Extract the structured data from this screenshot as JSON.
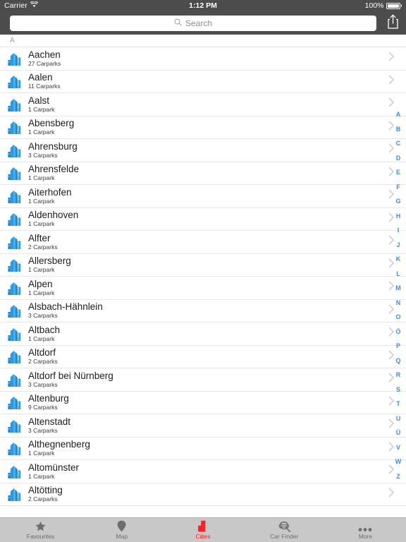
{
  "status_bar": {
    "carrier": "Carrier",
    "wifi_icon": "wifi-icon",
    "time": "1:12 PM",
    "battery_percent": "100%",
    "battery_icon": "battery-full-icon"
  },
  "nav_bar": {
    "search": {
      "placeholder": "Search",
      "value": "",
      "icon": "search-icon"
    },
    "share_button": {
      "icon": "share-icon",
      "label": ""
    }
  },
  "section": {
    "header": "A"
  },
  "list": {
    "rows": [
      {
        "city": "Aachen",
        "carparks": "27 Carparks",
        "icon": "city-buildings-icon",
        "chevron": "chevron-right-icon"
      },
      {
        "city": "Aalen",
        "carparks": "11 Carparks",
        "icon": "city-buildings-icon",
        "chevron": "chevron-right-icon"
      },
      {
        "city": "Aalst",
        "carparks": "1 Carpark",
        "icon": "city-buildings-icon",
        "chevron": "chevron-right-icon"
      },
      {
        "city": "Abensberg",
        "carparks": "1 Carpark",
        "icon": "city-buildings-icon",
        "chevron": "chevron-right-icon"
      },
      {
        "city": "Ahrensburg",
        "carparks": "3 Carparks",
        "icon": "city-buildings-icon",
        "chevron": "chevron-right-icon"
      },
      {
        "city": "Ahrensfelde",
        "carparks": "1 Carpark",
        "icon": "city-buildings-icon",
        "chevron": "chevron-right-icon"
      },
      {
        "city": "Aiterhofen",
        "carparks": "1 Carpark",
        "icon": "city-buildings-icon",
        "chevron": "chevron-right-icon"
      },
      {
        "city": "Aldenhoven",
        "carparks": "1 Carpark",
        "icon": "city-buildings-icon",
        "chevron": "chevron-right-icon"
      },
      {
        "city": "Alfter",
        "carparks": "2 Carparks",
        "icon": "city-buildings-icon",
        "chevron": "chevron-right-icon"
      },
      {
        "city": "Allersberg",
        "carparks": "1 Carpark",
        "icon": "city-buildings-icon",
        "chevron": "chevron-right-icon"
      },
      {
        "city": "Alpen",
        "carparks": "1 Carpark",
        "icon": "city-buildings-icon",
        "chevron": "chevron-right-icon"
      },
      {
        "city": "Alsbach-Hähnlein",
        "carparks": "3 Carparks",
        "icon": "city-buildings-icon",
        "chevron": "chevron-right-icon"
      },
      {
        "city": "Altbach",
        "carparks": "1 Carpark",
        "icon": "city-buildings-icon",
        "chevron": "chevron-right-icon"
      },
      {
        "city": "Altdorf",
        "carparks": "2 Carparks",
        "icon": "city-buildings-icon",
        "chevron": "chevron-right-icon"
      },
      {
        "city": "Altdorf bei Nürnberg",
        "carparks": "3 Carparks",
        "icon": "city-buildings-icon",
        "chevron": "chevron-right-icon"
      },
      {
        "city": "Altenburg",
        "carparks": "9 Carparks",
        "icon": "city-buildings-icon",
        "chevron": "chevron-right-icon"
      },
      {
        "city": "Altenstadt",
        "carparks": "3 Carparks",
        "icon": "city-buildings-icon",
        "chevron": "chevron-right-icon"
      },
      {
        "city": "Althegnenberg",
        "carparks": "1 Carpark",
        "icon": "city-buildings-icon",
        "chevron": "chevron-right-icon"
      },
      {
        "city": "Altomünster",
        "carparks": "1 Carpark",
        "icon": "city-buildings-icon",
        "chevron": "chevron-right-icon"
      },
      {
        "city": "Altötting",
        "carparks": "2 Carparks",
        "icon": "city-buildings-icon",
        "chevron": "chevron-right-icon"
      }
    ]
  },
  "index_bar": {
    "letters": [
      "A",
      "B",
      "C",
      "D",
      "E",
      "F",
      "G",
      "H",
      "I",
      "J",
      "K",
      "L",
      "M",
      "N",
      "O",
      "Ö",
      "P",
      "Q",
      "R",
      "S",
      "T",
      "U",
      "Ü",
      "V",
      "W",
      "Z"
    ]
  },
  "tab_bar": {
    "tabs": [
      {
        "label": "Favourites",
        "icon": "star-icon",
        "active": false
      },
      {
        "label": "Map",
        "icon": "map-pin-icon",
        "active": false
      },
      {
        "label": "Cities",
        "icon": "city-building-icon",
        "active": true
      },
      {
        "label": "Car Finder",
        "icon": "car-magnifier-icon",
        "active": false
      },
      {
        "label": "More",
        "icon": "ellipsis-icon",
        "active": false
      }
    ]
  },
  "colors": {
    "navbar": "#4c4c4c",
    "accent_red": "#fc2222",
    "index_blue": "#3b8cf0",
    "tabbar": "#c8c8c8",
    "building_blue": "#1b84d8"
  }
}
